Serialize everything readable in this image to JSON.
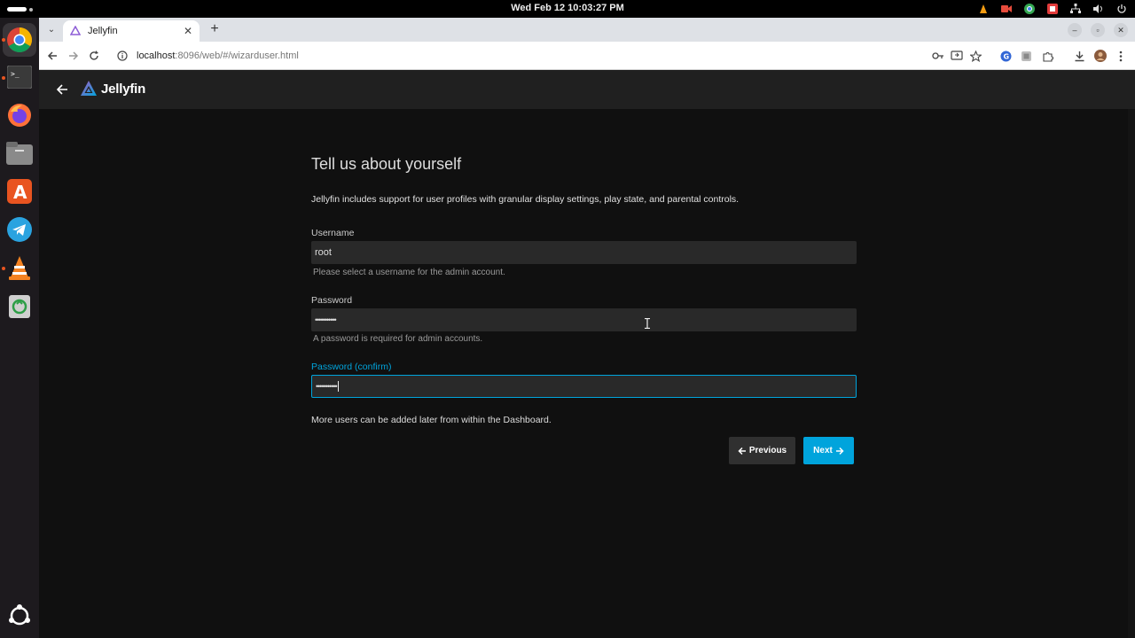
{
  "system": {
    "clock": "Wed Feb 12  10:03:27 PM"
  },
  "browser": {
    "tab_title": "Jellyfin",
    "url_host": "localhost",
    "url_rest": ":8096/web/#/wizarduser.html"
  },
  "app": {
    "brand": "Jellyfin"
  },
  "wizard": {
    "title": "Tell us about yourself",
    "intro": "Jellyfin includes support for user profiles with granular display settings, play state, and parental controls.",
    "username_label": "Username",
    "username_value": "root",
    "username_desc": "Please select a username for the admin account.",
    "password_label": "Password",
    "password_value": "•••••••••••",
    "password_desc": "A password is required for admin accounts.",
    "confirm_label": "Password (confirm)",
    "confirm_value": "•••••••••••",
    "note": "More users can be added later from within the Dashboard.",
    "previous_label": "Previous",
    "next_label": "Next"
  },
  "colors": {
    "accent": "#00a4dc",
    "background": "#101010",
    "header": "#202020"
  },
  "icons": {
    "dock": [
      "chrome-icon",
      "terminal-icon",
      "firefox-icon",
      "files-icon",
      "app-center-icon",
      "telegram-icon",
      "vlc-icon",
      "trash-icon",
      "ubuntu-icon"
    ]
  }
}
